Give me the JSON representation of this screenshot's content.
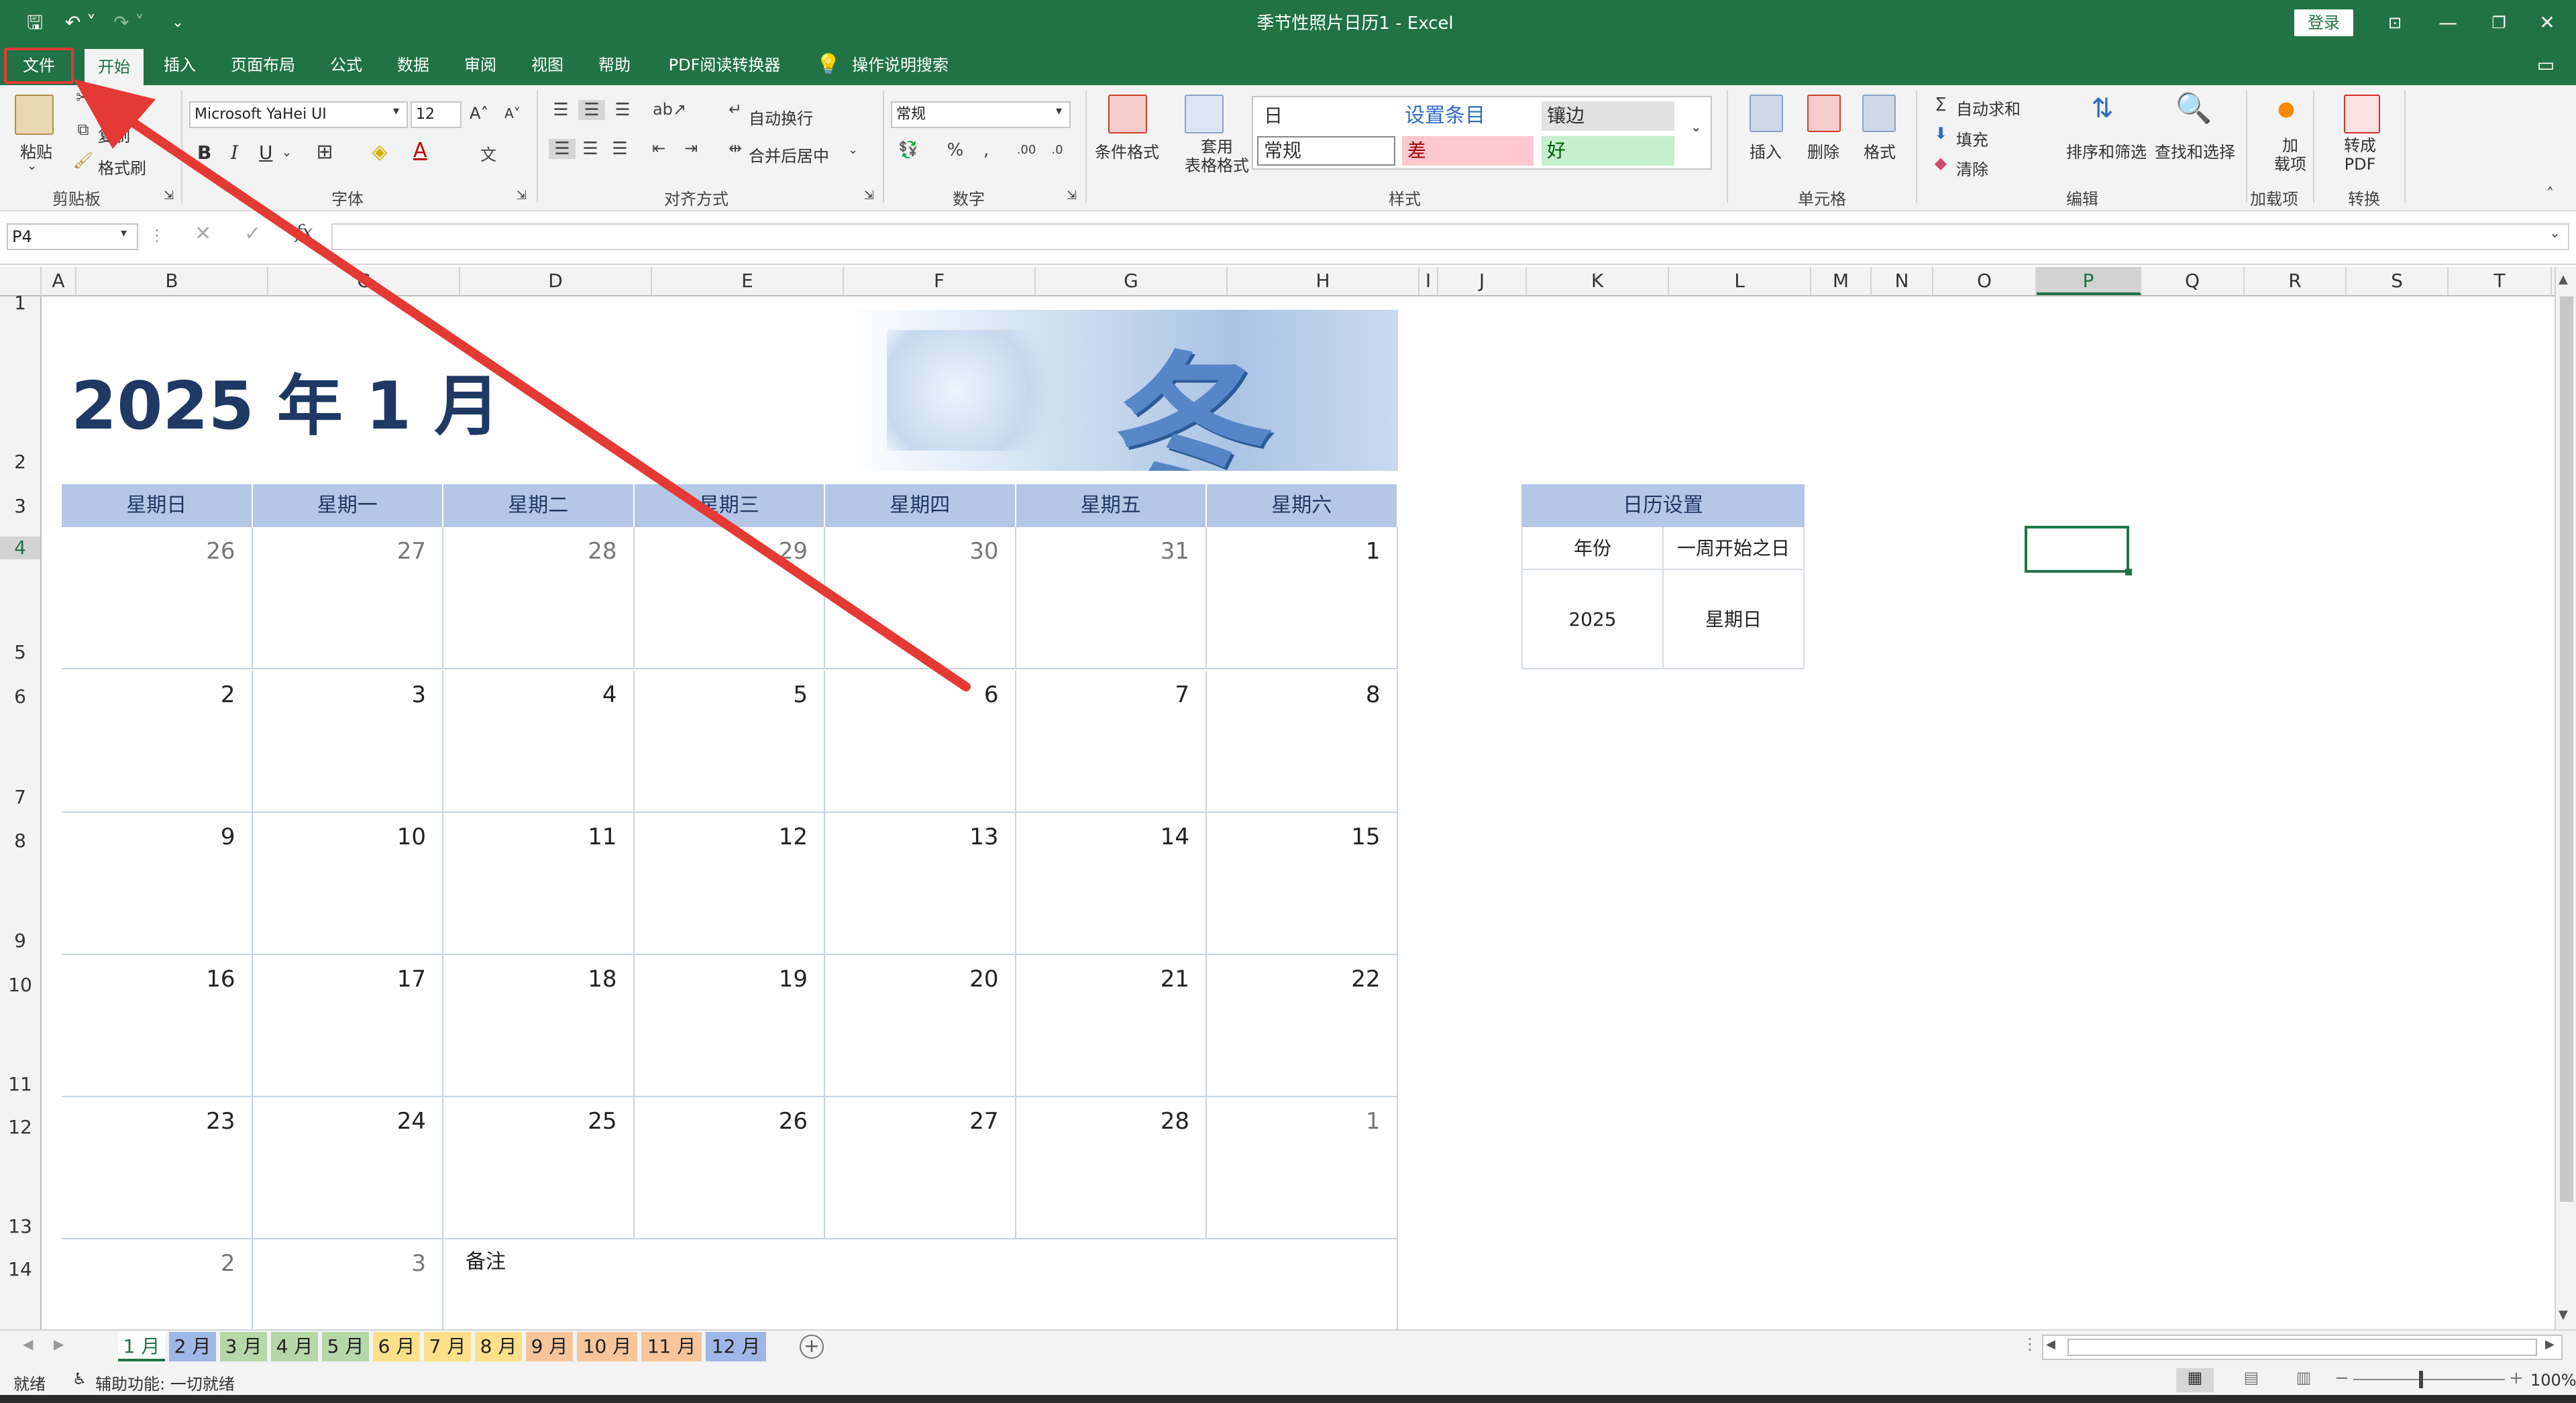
{
  "window": {
    "title": "季节性照片日历1  -  Excel",
    "login": "登录"
  },
  "tabs": [
    {
      "label": "文件"
    },
    {
      "label": "开始"
    },
    {
      "label": "插入"
    },
    {
      "label": "页面布局"
    },
    {
      "label": "公式"
    },
    {
      "label": "数据"
    },
    {
      "label": "审阅"
    },
    {
      "label": "视图"
    },
    {
      "label": "帮助"
    },
    {
      "label": "PDF阅读转换器"
    },
    {
      "label": "操作说明搜索"
    }
  ],
  "ribbon": {
    "clipboard": {
      "paste": "粘贴",
      "cut": "剪切",
      "copy": "复制",
      "format_painter": "格式刷",
      "name": "剪贴板"
    },
    "font": {
      "family": "Microsoft YaHei UI",
      "size": "12",
      "name": "字体",
      "bold": "B",
      "italic": "I",
      "underline": "U"
    },
    "alignment": {
      "wrap": "自动换行",
      "merge": "合并后居中",
      "name": "对齐方式"
    },
    "number": {
      "format": "常规",
      "name": "数字"
    },
    "styles": {
      "conditional": "条件格式",
      "table_format": "套用\n表格格式",
      "cells_top": [
        "日",
        "设置条目",
        "镶边"
      ],
      "cells_bottom": [
        "常规",
        "差",
        "好"
      ],
      "name": "样式"
    },
    "cells": {
      "insert": "插入",
      "delete": "删除",
      "format": "格式",
      "name": "单元格"
    },
    "editing": {
      "autosum": "自动求和",
      "fill": "填充",
      "clear": "清除",
      "sort": "排序和筛选",
      "find": "查找和选择",
      "name": "编辑"
    },
    "addins": {
      "label": "加\n载项",
      "name": "加载项"
    },
    "convert": {
      "label": "转成\nPDF",
      "name": "转换"
    }
  },
  "formula_bar": {
    "name_box": "P4",
    "value": ""
  },
  "columns": [
    "A",
    "B",
    "C",
    "D",
    "E",
    "F",
    "G",
    "H",
    "I",
    "J",
    "K",
    "L",
    "M",
    "N",
    "O",
    "P",
    "Q",
    "R",
    "S",
    "T"
  ],
  "rows": [
    "1",
    "2",
    "3",
    "4",
    "5",
    "6",
    "7",
    "8",
    "9",
    "10",
    "11",
    "12",
    "13",
    "14"
  ],
  "calendar": {
    "title": "2025 年 1 月",
    "banner": "冬季",
    "weekdays": [
      "星期日",
      "星期一",
      "星期二",
      "星期三",
      "星期四",
      "星期五",
      "星期六"
    ],
    "weeks": [
      [
        "26",
        "27",
        "28",
        "29",
        "30",
        "31",
        "1"
      ],
      [
        "2",
        "3",
        "4",
        "5",
        "6",
        "7",
        "8"
      ],
      [
        "9",
        "10",
        "11",
        "12",
        "13",
        "14",
        "15"
      ],
      [
        "16",
        "17",
        "18",
        "19",
        "20",
        "21",
        "22"
      ],
      [
        "23",
        "24",
        "25",
        "26",
        "27",
        "28",
        "1"
      ]
    ],
    "last_row": [
      "2",
      "3"
    ],
    "notes": "备注"
  },
  "settings": {
    "header": "日历设置",
    "year_label": "年份",
    "weekstart_label": "一周开始之日",
    "year": "2025",
    "weekstart": "星期日"
  },
  "sheet_tabs": [
    {
      "label": "1 月",
      "color": "#ffffff"
    },
    {
      "label": "2 月",
      "color": "#9fb7e6"
    },
    {
      "label": "3 月",
      "color": "#b6d7a8"
    },
    {
      "label": "4 月",
      "color": "#b6d7a8"
    },
    {
      "label": "5 月",
      "color": "#b6d7a8"
    },
    {
      "label": "6 月",
      "color": "#ffe08a"
    },
    {
      "label": "7 月",
      "color": "#ffe08a"
    },
    {
      "label": "8 月",
      "color": "#ffe08a"
    },
    {
      "label": "9 月",
      "color": "#f6c59b"
    },
    {
      "label": "10 月",
      "color": "#f6c59b"
    },
    {
      "label": "11 月",
      "color": "#f6c59b"
    },
    {
      "label": "12 月",
      "color": "#9fb7e6"
    }
  ],
  "status": {
    "ready": "就绪",
    "accessibility": "辅助功能: 一切就绪",
    "zoom": "100%"
  },
  "colors": {
    "excel_green": "#217346",
    "header_blue": "#b4c7e7",
    "title_navy": "#1f3864",
    "annotation_red": "#e53935"
  }
}
